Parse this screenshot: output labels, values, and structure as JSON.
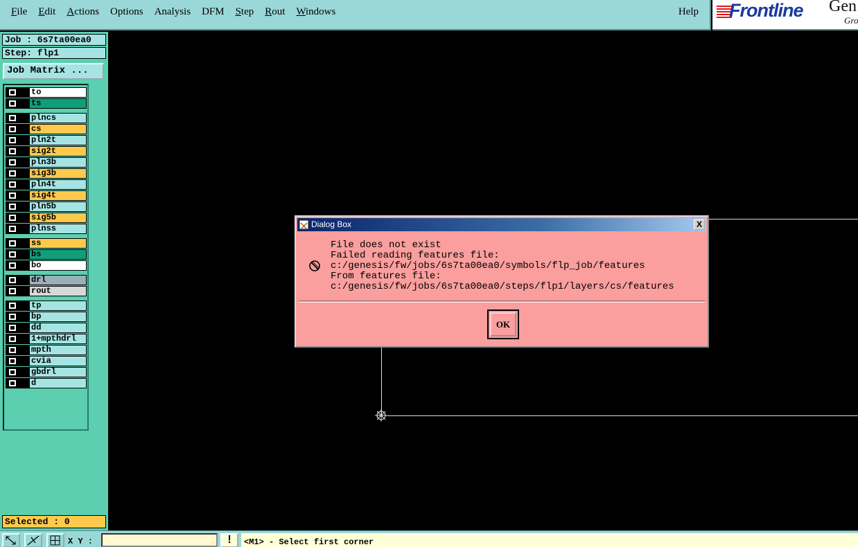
{
  "menubar": {
    "items": [
      "File",
      "Edit",
      "Actions",
      "Options",
      "Analysis",
      "DFM",
      "Step",
      "Rout",
      "Windows"
    ],
    "help": "Help"
  },
  "brand": {
    "name": "Frontline",
    "gen": "Gen",
    "gro": "Gro"
  },
  "left_panel": {
    "job": "Job : 6s7ta00ea0",
    "step": "Step: flp1",
    "job_matrix_label": "Job Matrix ...",
    "layers": [
      {
        "name": "to",
        "color": "#ffffff"
      },
      {
        "name": "ts",
        "color": "#0fa07a"
      },
      {
        "name": "plncs",
        "color": "#a6e4e4"
      },
      {
        "name": "cs",
        "color": "#ffc94d"
      },
      {
        "name": "pln2t",
        "color": "#a6e4e4"
      },
      {
        "name": "sig2t",
        "color": "#ffc94d"
      },
      {
        "name": "pln3b",
        "color": "#a6e4e4"
      },
      {
        "name": "sig3b",
        "color": "#ffc94d"
      },
      {
        "name": "pln4t",
        "color": "#a6e4e4"
      },
      {
        "name": "sig4t",
        "color": "#ffc94d"
      },
      {
        "name": "pln5b",
        "color": "#a6e4e4"
      },
      {
        "name": "sig5b",
        "color": "#ffc94d"
      },
      {
        "name": "plnss",
        "color": "#a6e4e4"
      },
      {
        "name": "ss",
        "color": "#ffc94d"
      },
      {
        "name": "bs",
        "color": "#0fa07a"
      },
      {
        "name": "bo",
        "color": "#ffffff"
      },
      {
        "name": "drl",
        "color": "#9ab0b8"
      },
      {
        "name": "rout",
        "color": "#d8d8d8"
      },
      {
        "name": "tp",
        "color": "#a6e4e4"
      },
      {
        "name": "bp",
        "color": "#a6e4e4"
      },
      {
        "name": "dd",
        "color": "#a6e4e4"
      },
      {
        "name": "1+mpthdrl",
        "color": "#a6e4e4"
      },
      {
        "name": "mpth",
        "color": "#a6e4e4"
      },
      {
        "name": "cvia",
        "color": "#a6e4e4"
      },
      {
        "name": "gbdrl",
        "color": "#a6e4e4"
      },
      {
        "name": "d",
        "color": "#a6e4e4"
      }
    ],
    "selected": "Selected : 0"
  },
  "statusbar": {
    "xy_label": "X Y :",
    "xy_value": "",
    "warn": "!",
    "message": "<M1> - Select first corner"
  },
  "dialog": {
    "title": "Dialog Box",
    "message": "File does not exist\nFailed reading features file:\nc:/genesis/fw/jobs/6s7ta00ea0/symbols/flp_job/features\nFrom features file:\nc:/genesis/fw/jobs/6s7ta00ea0/steps/flp1/layers/cs/features",
    "ok_label": "OK",
    "close_label": "X"
  }
}
